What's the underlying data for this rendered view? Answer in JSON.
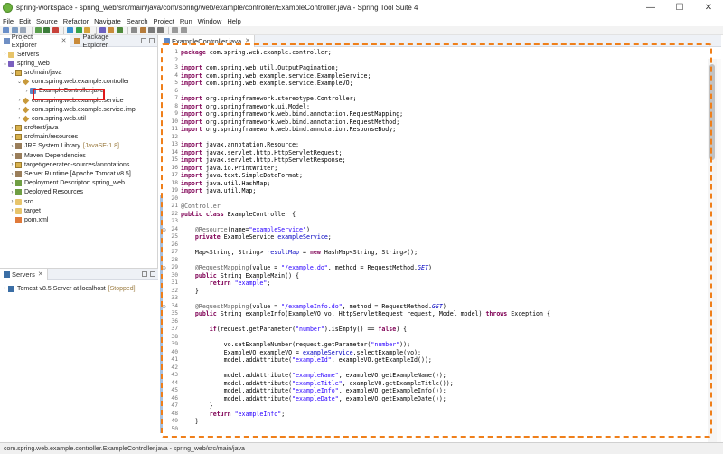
{
  "window": {
    "title": "spring-workspace - spring_web/src/main/java/com/spring/web/example/controller/ExampleController.java - Spring Tool Suite 4",
    "controls": [
      "—",
      "☐",
      "✕"
    ]
  },
  "menu": [
    "File",
    "Edit",
    "Source",
    "Refactor",
    "Navigate",
    "Search",
    "Project",
    "Run",
    "Window",
    "Help"
  ],
  "left_tabs": [
    {
      "label": "Project Explorer",
      "active": true
    },
    {
      "label": "Package Explorer",
      "active": false
    }
  ],
  "tree": [
    {
      "indent": 0,
      "arrow": "›",
      "icon": "folder",
      "label": "Servers",
      "decor": ""
    },
    {
      "indent": 0,
      "arrow": "⌄",
      "icon": "project",
      "label": "spring_web",
      "decor": ""
    },
    {
      "indent": 1,
      "arrow": "⌄",
      "icon": "src",
      "label": "src/main/java",
      "decor": ""
    },
    {
      "indent": 2,
      "arrow": "⌄",
      "icon": "pkg",
      "label": "com.spring.web.example.controller",
      "decor": ""
    },
    {
      "indent": 3,
      "arrow": "›",
      "icon": "java",
      "label": "ExampleController.java",
      "decor": ""
    },
    {
      "indent": 2,
      "arrow": "›",
      "icon": "pkg",
      "label": "com.spring.web.example.service",
      "decor": ""
    },
    {
      "indent": 2,
      "arrow": "›",
      "icon": "pkg",
      "label": "com.spring.web.example.service.impl",
      "decor": ""
    },
    {
      "indent": 2,
      "arrow": "›",
      "icon": "pkg",
      "label": "com.spring.web.util",
      "decor": ""
    },
    {
      "indent": 1,
      "arrow": "›",
      "icon": "src",
      "label": "src/test/java",
      "decor": ""
    },
    {
      "indent": 1,
      "arrow": "›",
      "icon": "src",
      "label": "src/main/resources",
      "decor": ""
    },
    {
      "indent": 1,
      "arrow": "›",
      "icon": "lib",
      "label": "JRE System Library",
      "decor": "[JavaSE-1.8]"
    },
    {
      "indent": 1,
      "arrow": "›",
      "icon": "lib",
      "label": "Maven Dependencies",
      "decor": ""
    },
    {
      "indent": 1,
      "arrow": "›",
      "icon": "src",
      "label": "target/generated-sources/annotations",
      "decor": ""
    },
    {
      "indent": 1,
      "arrow": "›",
      "icon": "lib",
      "label": "Server Runtime [Apache Tomcat v8.5]",
      "decor": ""
    },
    {
      "indent": 1,
      "arrow": "›",
      "icon": "descriptor",
      "label": "Deployment Descriptor: spring_web",
      "decor": ""
    },
    {
      "indent": 1,
      "arrow": "›",
      "icon": "descriptor",
      "label": "Deployed Resources",
      "decor": ""
    },
    {
      "indent": 1,
      "arrow": "›",
      "icon": "folder",
      "label": "src",
      "decor": ""
    },
    {
      "indent": 1,
      "arrow": "›",
      "icon": "folder",
      "label": "target",
      "decor": ""
    },
    {
      "indent": 1,
      "arrow": "",
      "icon": "xml",
      "label": "pom.xml",
      "decor": ""
    }
  ],
  "servers_view": {
    "tab_label": "Servers",
    "rows": [
      {
        "label": "Tomcat v8.5 Server at localhost",
        "decor": "[Stopped]"
      }
    ]
  },
  "editor": {
    "tab_label": "ExampleController.java",
    "lines": [
      {
        "n": 1,
        "t": [
          [
            "k",
            "package"
          ],
          [
            "p",
            " com.spring.web.example.controller;"
          ]
        ]
      },
      {
        "n": 2,
        "t": []
      },
      {
        "n": 3,
        "t": [
          [
            "k",
            "import"
          ],
          [
            "p",
            " com.spring.web.util.OutputPagination;"
          ]
        ]
      },
      {
        "n": 4,
        "t": [
          [
            "k",
            "import"
          ],
          [
            "p",
            " com.spring.web.example.service.ExampleService;"
          ]
        ]
      },
      {
        "n": 5,
        "t": [
          [
            "k",
            "import"
          ],
          [
            "p",
            " com.spring.web.example.service.ExampleVO;"
          ]
        ]
      },
      {
        "n": 6,
        "t": []
      },
      {
        "n": 7,
        "t": [
          [
            "k",
            "import"
          ],
          [
            "p",
            " org.springframework.stereotype.Controller;"
          ]
        ]
      },
      {
        "n": 8,
        "t": [
          [
            "k",
            "import"
          ],
          [
            "p",
            " org.springframework.ui.Model;"
          ]
        ]
      },
      {
        "n": 9,
        "t": [
          [
            "k",
            "import"
          ],
          [
            "p",
            " org.springframework.web.bind.annotation.RequestMapping;"
          ]
        ]
      },
      {
        "n": 10,
        "t": [
          [
            "k",
            "import"
          ],
          [
            "p",
            " org.springframework.web.bind.annotation.RequestMethod;"
          ]
        ]
      },
      {
        "n": 11,
        "t": [
          [
            "k",
            "import"
          ],
          [
            "p",
            " org.springframework.web.bind.annotation.ResponseBody;"
          ]
        ]
      },
      {
        "n": 12,
        "t": []
      },
      {
        "n": 13,
        "t": [
          [
            "k",
            "import"
          ],
          [
            "p",
            " javax.annotation.Resource;"
          ]
        ]
      },
      {
        "n": 14,
        "t": [
          [
            "k",
            "import"
          ],
          [
            "p",
            " javax.servlet.http.HttpServletRequest;"
          ]
        ]
      },
      {
        "n": 15,
        "t": [
          [
            "k",
            "import"
          ],
          [
            "p",
            " javax.servlet.http.HttpServletResponse;"
          ]
        ]
      },
      {
        "n": 16,
        "t": [
          [
            "k",
            "import"
          ],
          [
            "p",
            " java.io.PrintWriter;"
          ]
        ]
      },
      {
        "n": 17,
        "t": [
          [
            "k",
            "import"
          ],
          [
            "p",
            " java.text.SimpleDateFormat;"
          ]
        ]
      },
      {
        "n": 18,
        "t": [
          [
            "k",
            "import"
          ],
          [
            "p",
            " java.util.HashMap;"
          ]
        ]
      },
      {
        "n": 19,
        "t": [
          [
            "k",
            "import"
          ],
          [
            "p",
            " java.util.Map;"
          ]
        ]
      },
      {
        "n": 20,
        "t": []
      },
      {
        "n": 21,
        "t": [
          [
            "a",
            "@Controller"
          ]
        ]
      },
      {
        "n": 22,
        "t": [
          [
            "k",
            "public"
          ],
          [
            "p",
            " "
          ],
          [
            "k",
            "class"
          ],
          [
            "p",
            " ExampleController {"
          ]
        ]
      },
      {
        "n": 23,
        "t": []
      },
      {
        "n": 24,
        "fold": true,
        "t": [
          [
            "p",
            "    "
          ],
          [
            "a",
            "@Resource"
          ],
          [
            "p",
            "(name="
          ],
          [
            "s",
            "\"exampleService\""
          ],
          [
            "p",
            ")"
          ]
        ]
      },
      {
        "n": 25,
        "t": [
          [
            "p",
            "    "
          ],
          [
            "k",
            "private"
          ],
          [
            "p",
            " ExampleService "
          ],
          [
            "f",
            "exampleService"
          ],
          [
            "p",
            ";"
          ]
        ]
      },
      {
        "n": 26,
        "t": []
      },
      {
        "n": 27,
        "t": [
          [
            "p",
            "    Map<String, String> "
          ],
          [
            "f",
            "resultMap"
          ],
          [
            "p",
            " = "
          ],
          [
            "k",
            "new"
          ],
          [
            "p",
            " HashMap<String, String>();"
          ]
        ]
      },
      {
        "n": 28,
        "t": []
      },
      {
        "n": 29,
        "fold": true,
        "t": [
          [
            "p",
            "    "
          ],
          [
            "a",
            "@RequestMapping"
          ],
          [
            "p",
            "(value = "
          ],
          [
            "s",
            "\"/example.do\""
          ],
          [
            "p",
            ", method = RequestMethod."
          ],
          [
            "fi",
            "GET"
          ],
          [
            "p",
            ")"
          ]
        ]
      },
      {
        "n": 30,
        "t": [
          [
            "p",
            "    "
          ],
          [
            "k",
            "public"
          ],
          [
            "p",
            " String ExampleMain() {"
          ]
        ]
      },
      {
        "n": 31,
        "t": [
          [
            "p",
            "        "
          ],
          [
            "k",
            "return"
          ],
          [
            "p",
            " "
          ],
          [
            "s",
            "\"example\""
          ],
          [
            "p",
            ";"
          ]
        ]
      },
      {
        "n": 32,
        "t": [
          [
            "p",
            "    }"
          ]
        ]
      },
      {
        "n": 33,
        "t": []
      },
      {
        "n": 34,
        "fold": true,
        "t": [
          [
            "p",
            "    "
          ],
          [
            "a",
            "@RequestMapping"
          ],
          [
            "p",
            "(value = "
          ],
          [
            "s",
            "\"/exampleInfo.do\""
          ],
          [
            "p",
            ", method = RequestMethod."
          ],
          [
            "fi",
            "GET"
          ],
          [
            "p",
            ")"
          ]
        ]
      },
      {
        "n": 35,
        "t": [
          [
            "p",
            "    "
          ],
          [
            "k",
            "public"
          ],
          [
            "p",
            " String exampleInfo(ExampleVO vo, HttpServletRequest request, Model model) "
          ],
          [
            "k",
            "throws"
          ],
          [
            "p",
            " Exception {"
          ]
        ]
      },
      {
        "n": 36,
        "t": []
      },
      {
        "n": 37,
        "t": [
          [
            "p",
            "        "
          ],
          [
            "k",
            "if"
          ],
          [
            "p",
            "(request.getParameter("
          ],
          [
            "s",
            "\"number\""
          ],
          [
            "p",
            ").isEmpty() == "
          ],
          [
            "k",
            "false"
          ],
          [
            "p",
            ") {"
          ]
        ]
      },
      {
        "n": 38,
        "t": []
      },
      {
        "n": 39,
        "t": [
          [
            "p",
            "            vo.setExampleNumber(request.getParameter("
          ],
          [
            "s",
            "\"number\""
          ],
          [
            "p",
            "));"
          ]
        ]
      },
      {
        "n": 40,
        "t": [
          [
            "p",
            "            ExampleVO exampleVO = "
          ],
          [
            "f",
            "exampleService"
          ],
          [
            "p",
            ".selectExample(vo);"
          ]
        ]
      },
      {
        "n": 41,
        "t": [
          [
            "p",
            "            model.addAttribute("
          ],
          [
            "s",
            "\"exampleId\""
          ],
          [
            "p",
            ", exampleVO.getExampleId());"
          ]
        ]
      },
      {
        "n": 42,
        "t": []
      },
      {
        "n": 43,
        "t": [
          [
            "p",
            "            model.addAttribute("
          ],
          [
            "s",
            "\"exampleName\""
          ],
          [
            "p",
            ", exampleVO.getExampleName());"
          ]
        ]
      },
      {
        "n": 44,
        "t": [
          [
            "p",
            "            model.addAttribute("
          ],
          [
            "s",
            "\"exampleTitle\""
          ],
          [
            "p",
            ", exampleVO.getExampleTitle());"
          ]
        ]
      },
      {
        "n": 45,
        "t": [
          [
            "p",
            "            model.addAttribute("
          ],
          [
            "s",
            "\"exampleInfo\""
          ],
          [
            "p",
            ", exampleVO.getExampleInfo());"
          ]
        ]
      },
      {
        "n": 46,
        "t": [
          [
            "p",
            "            model.addAttribute("
          ],
          [
            "s",
            "\"exampleDate\""
          ],
          [
            "p",
            ", exampleVO.getExampleDate());"
          ]
        ]
      },
      {
        "n": 47,
        "t": [
          [
            "p",
            "        }"
          ]
        ]
      },
      {
        "n": 48,
        "t": [
          [
            "p",
            "        "
          ],
          [
            "k",
            "return"
          ],
          [
            "p",
            " "
          ],
          [
            "s",
            "\"exampleInfo\""
          ],
          [
            "p",
            ";"
          ]
        ]
      },
      {
        "n": 49,
        "t": [
          [
            "p",
            "    }"
          ]
        ]
      },
      {
        "n": 50,
        "t": []
      }
    ]
  },
  "status_bar": "com.spring.web.example.controller.ExampleController.java - spring_web/src/main/java",
  "colors": {
    "keyword": "#7f0055",
    "string": "#2a00ff",
    "annotation": "#646464",
    "field": "#0000c0",
    "highlight_box": "#e01a1a",
    "dashed_box": "#ef7f1a"
  }
}
